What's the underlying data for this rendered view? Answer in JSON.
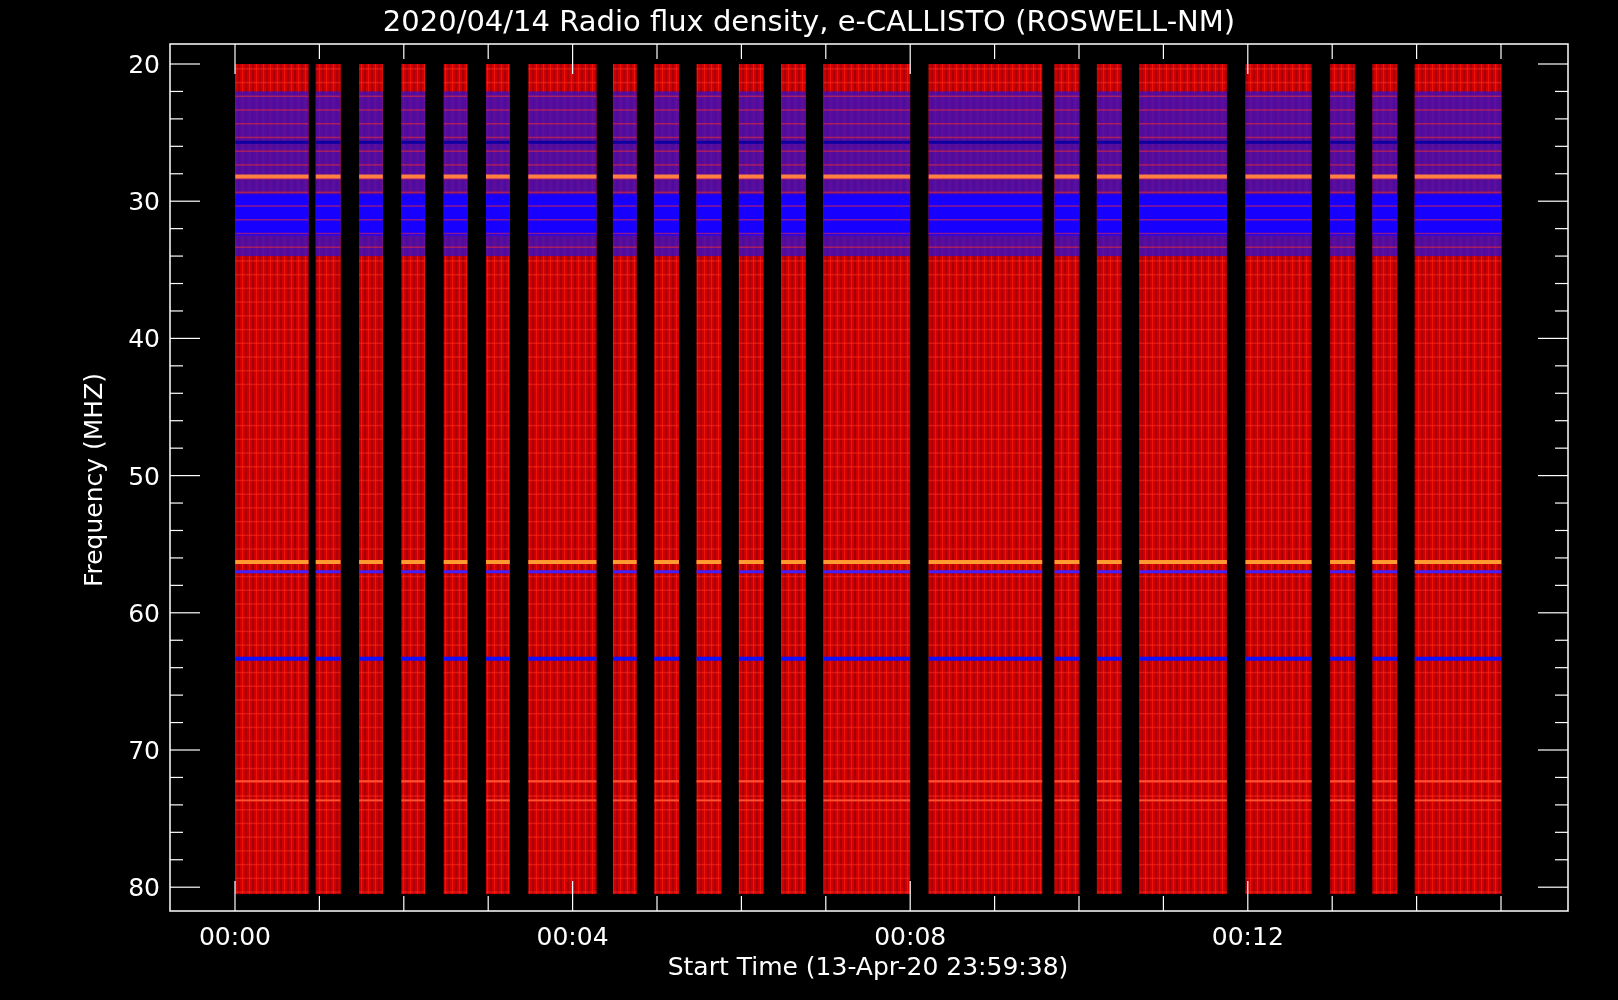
{
  "title": "2020/04/14  Radio flux density, e-CALLISTO (ROSWELL-NM)",
  "ylabel": "Frequency (MHZ)",
  "xlabel": "Start Time (13-Apr-20 23:59:38)",
  "yticks": [
    "20",
    "30",
    "40",
    "50",
    "60",
    "70",
    "80"
  ],
  "xticks": [
    "00:00",
    "00:04",
    "00:08",
    "00:12"
  ]
}
